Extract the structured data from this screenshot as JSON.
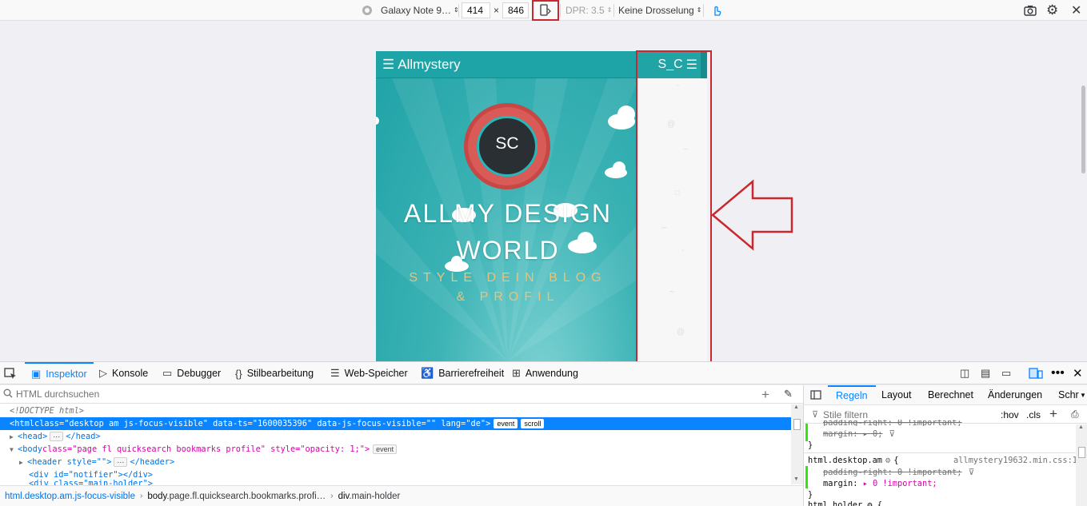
{
  "rdm_toolbar": {
    "device": "Galaxy Note 9…",
    "width": "414",
    "times": "×",
    "height": "846",
    "dpr": "DPR: 3.5",
    "throttling": "Keine Drosselung"
  },
  "page": {
    "logo": "Allmystery",
    "hamburger": "☰",
    "badge_text": "SC",
    "hero_title_line1": "ALLMY DESIGN",
    "hero_title_line2": "WORLD",
    "hero_sub_line1": "STYLE DEIN BLOG",
    "hero_sub_line2": "& PROFIL",
    "sidepanel_label": "S_C"
  },
  "devtools": {
    "tabs": [
      "Inspektor",
      "Konsole",
      "Debugger",
      "Stilbearbeitung",
      "Web-Speicher",
      "Barrierefreiheit",
      "Anwendung"
    ],
    "search_placeholder": "HTML durchsuchen",
    "markup": {
      "doctype": "<!DOCTYPE html>",
      "html_open": "<html",
      "html_attrs": " class=\"desktop am js-focus-visible\" data-ts=\"1600035396\" data-js-focus-visible=\"\" lang=\"de\">",
      "html_badge1": "event",
      "html_badge2": "scroll",
      "head": "<head>",
      "head_close": "</head>",
      "body_open": "<body",
      "body_attrs": " class=\"page fl quicksearch bookmarks profile\" style=\"opacity: 1;\">",
      "body_badge": "event",
      "header": "<header style=\"\">",
      "header_close": "</header>",
      "div_notifier": "<div id=\"notifier\"></div>",
      "div_partial": "<div class=\"main-holder\">"
    },
    "breadcrumb": [
      {
        "tag": "html",
        "rest": ".desktop.am.js-focus-visible"
      },
      {
        "tag": "body",
        "rest": ".page.fl.quicksearch.bookmarks.profi…"
      },
      {
        "tag": "div",
        "rest": ".main-holder"
      }
    ],
    "rules_tabs": [
      "Regeln",
      "Layout",
      "Berechnet",
      "Änderungen",
      "Schr"
    ],
    "rules_filter_placeholder": "Stile filtern",
    "hov": ":hov",
    "cls": ".cls",
    "rules": {
      "partial_top": "padding-right: 0 !important;",
      "margin_struck": "margin: ▸ 0;",
      "close": "}",
      "selector": "html.desktop.am",
      "brace_open": "{",
      "source": "allmystery19632.min.css:1",
      "padding_struck": "padding-right: 0 !important;",
      "margin_prop": "margin:",
      "margin_val": "▸ 0 !important;",
      "bottom_partial": "html.holder ⚙ {"
    }
  }
}
